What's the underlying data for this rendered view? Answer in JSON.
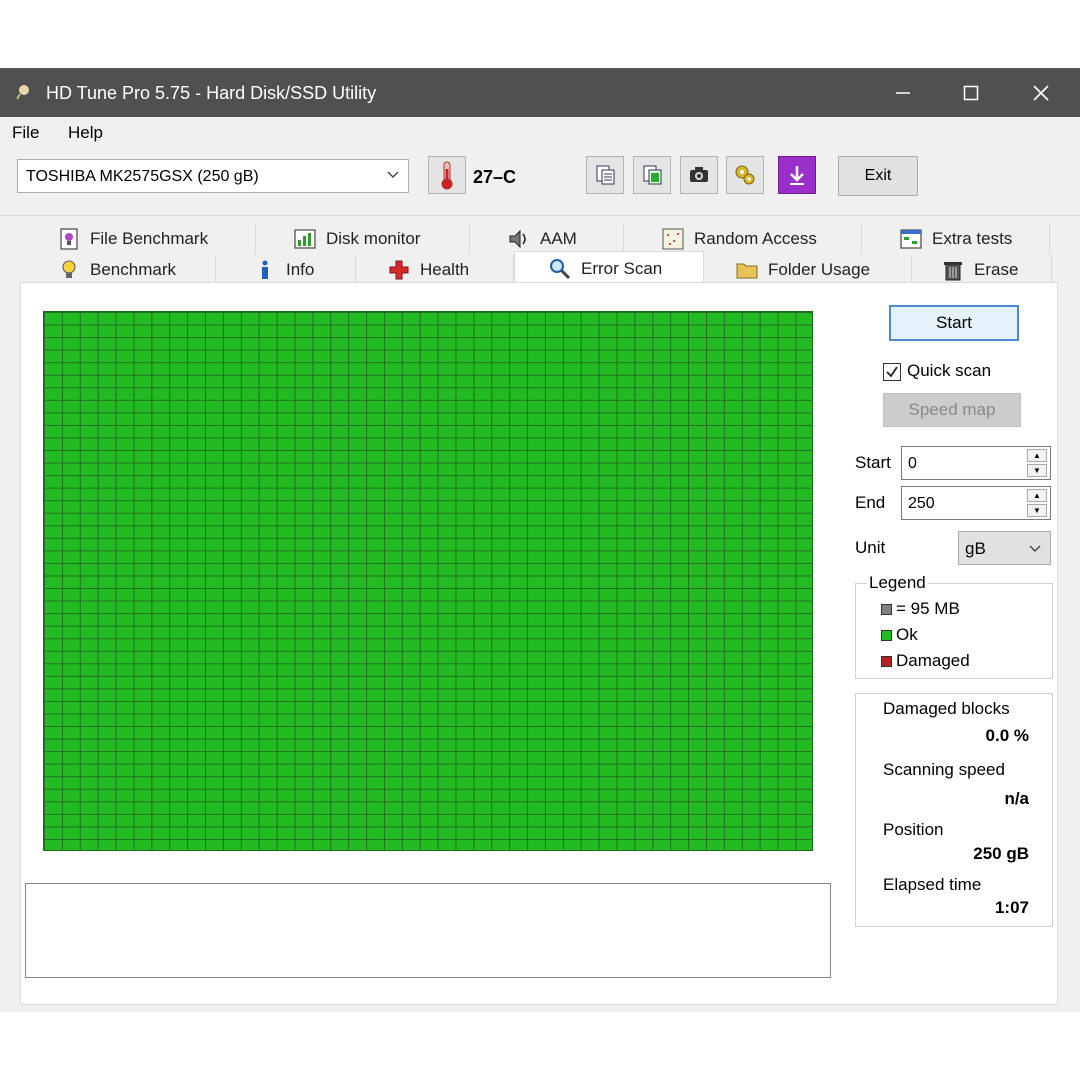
{
  "window": {
    "title": "HD Tune Pro 5.75 - Hard Disk/SSD Utility"
  },
  "menu": {
    "file": "File",
    "help": "Help"
  },
  "toolbar": {
    "drive": "TOSHIBA MK2575GSX (250 gB)",
    "temperature": "27–C",
    "exit_label": "Exit"
  },
  "tabs_top": [
    {
      "label": "File Benchmark",
      "icon": "file-benchmark-icon"
    },
    {
      "label": "Disk monitor",
      "icon": "disk-monitor-icon"
    },
    {
      "label": "AAM",
      "icon": "speaker-icon"
    },
    {
      "label": "Random Access",
      "icon": "random-access-icon"
    },
    {
      "label": "Extra tests",
      "icon": "extra-tests-icon"
    }
  ],
  "tabs_bottom": [
    {
      "label": "Benchmark",
      "icon": "lightbulb-icon"
    },
    {
      "label": "Info",
      "icon": "info-icon"
    },
    {
      "label": "Health",
      "icon": "health-cross-icon"
    },
    {
      "label": "Error Scan",
      "icon": "magnifier-icon",
      "active": true
    },
    {
      "label": "Folder Usage",
      "icon": "folder-icon"
    },
    {
      "label": "Erase",
      "icon": "trash-icon"
    }
  ],
  "error_scan": {
    "start_label": "Start",
    "quick_scan_label": "Quick scan",
    "quick_scan_checked": true,
    "speed_map_label": "Speed map",
    "start_field_label": "Start",
    "start_value": "0",
    "end_field_label": "End",
    "end_value": "250",
    "unit_label": "Unit",
    "unit_value": "gB",
    "legend": {
      "title": "Legend",
      "block_size": "= 95 MB",
      "ok": "Ok",
      "damaged": "Damaged",
      "colors": {
        "block": "#808080",
        "ok": "#22bb22",
        "damaged": "#b22222"
      }
    },
    "stats": {
      "damaged_blocks_label": "Damaged blocks",
      "damaged_blocks_value": "0.0 %",
      "scanning_speed_label": "Scanning speed",
      "scanning_speed_value": "n/a",
      "position_label": "Position",
      "position_value": "250 gB",
      "elapsed_label": "Elapsed time",
      "elapsed_value": "1:07"
    },
    "grid_status": "all blocks ok"
  }
}
